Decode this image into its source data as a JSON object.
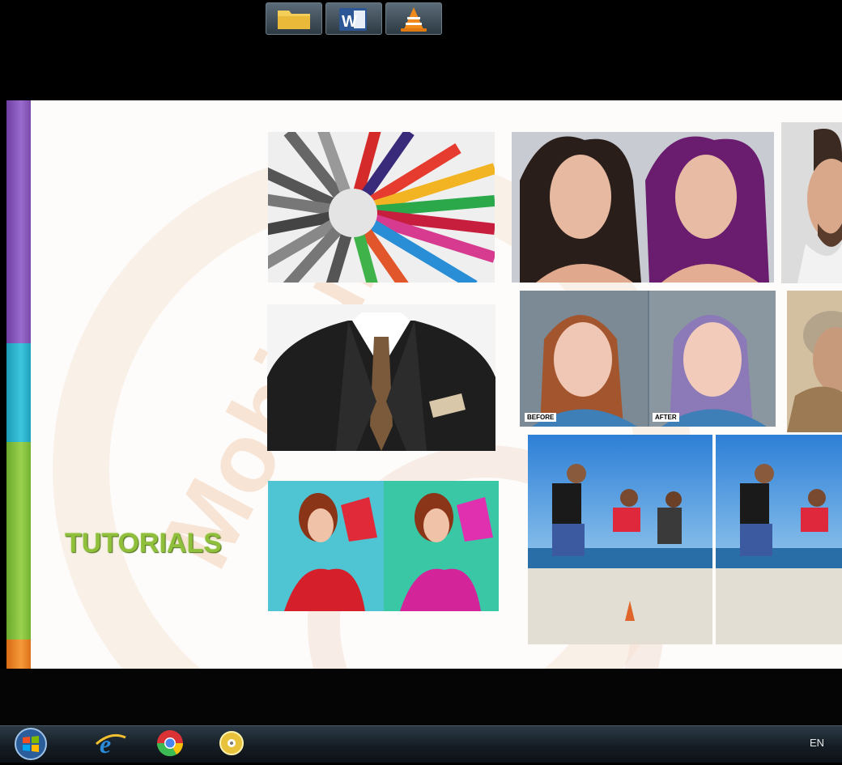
{
  "slide": {
    "heading": "TUTORIALS",
    "watermark": "Mobitube"
  },
  "photos": {
    "before_label": "BEFORE",
    "after_label": "AFTER"
  },
  "taskbar": {
    "language": "EN"
  },
  "colors": {
    "stripe_purple": "#8a5cc2",
    "stripe_cyan": "#33bcd6",
    "stripe_green": "#8cc63f",
    "stripe_orange": "#f08a2a",
    "heading_green": "#8fbf3b"
  }
}
